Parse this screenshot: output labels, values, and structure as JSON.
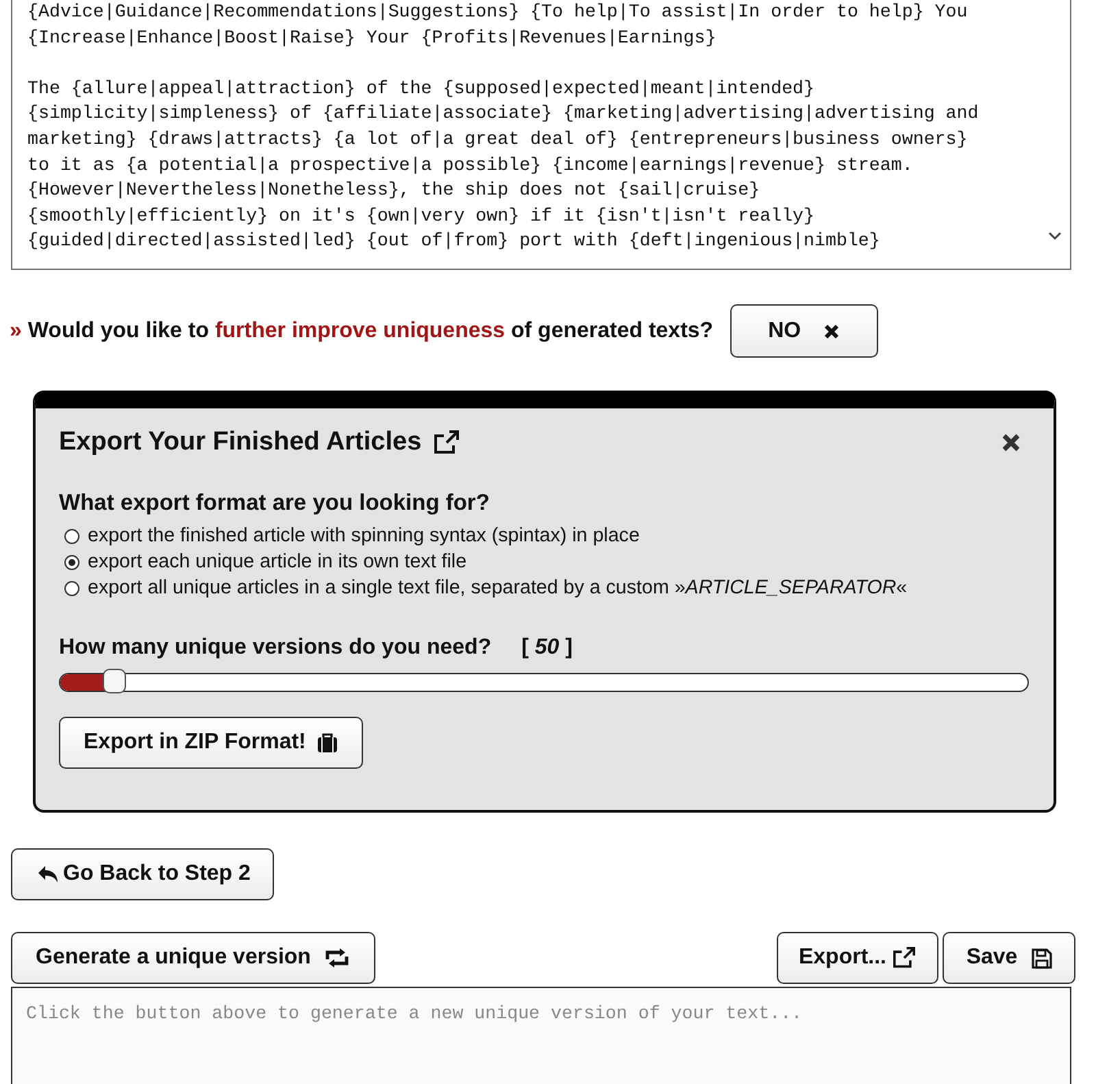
{
  "source_text": {
    "paragraphs": [
      [
        "{Advice|Guidance|Recommendations|Suggestions} {To help|To assist|In order to help} You",
        "{Increase|Enhance|Boost|Raise} Your {Profits|Revenues|Earnings}"
      ],
      [
        "The {allure|appeal|attraction} of the {supposed|expected|meant|intended}",
        "{simplicity|simpleness} of {affiliate|associate} {marketing|advertising|advertising and",
        "marketing} {draws|attracts} {a lot of|a great deal of} {entrepreneurs|business owners}",
        "to it as {a potential|a prospective|a possible} {income|earnings|revenue} stream.",
        "{However|Nevertheless|Nonetheless}, the ship does not {sail|cruise}",
        "{smoothly|efficiently} on it's {own|very own} if it {isn't|isn't really}",
        "{guided|directed|assisted|led} {out of|from} port with {deft|ingenious|nimble}"
      ]
    ]
  },
  "uniqueness_question": {
    "marker": "»",
    "before": "Would you like to",
    "highlight": "further improve uniqueness",
    "after": "of generated texts?",
    "button": "NO"
  },
  "export_panel": {
    "title": "Export Your Finished Articles",
    "format_question": "What export format are you looking for?",
    "options": [
      {
        "label": "export the finished article with spinning syntax (spintax) in place",
        "selected": false
      },
      {
        "label": "export each unique article in its own text file",
        "selected": true
      },
      {
        "label": "export all unique articles in a single text file, separated by a custom »*ARTICLE_SEPARATOR*«",
        "selected": false
      }
    ],
    "versions_label": "How many unique versions do you need?",
    "versions_count": "[ *50* ]",
    "level": 0.05,
    "zip_button": "Export in ZIP Format!"
  },
  "back_button": "Go Back to Step 2",
  "generate_button": "Generate a unique version",
  "export_button": "Export...",
  "save_button": "Save",
  "output": {
    "placeholder": "Click the button above to generate a new unique version of your text..."
  }
}
